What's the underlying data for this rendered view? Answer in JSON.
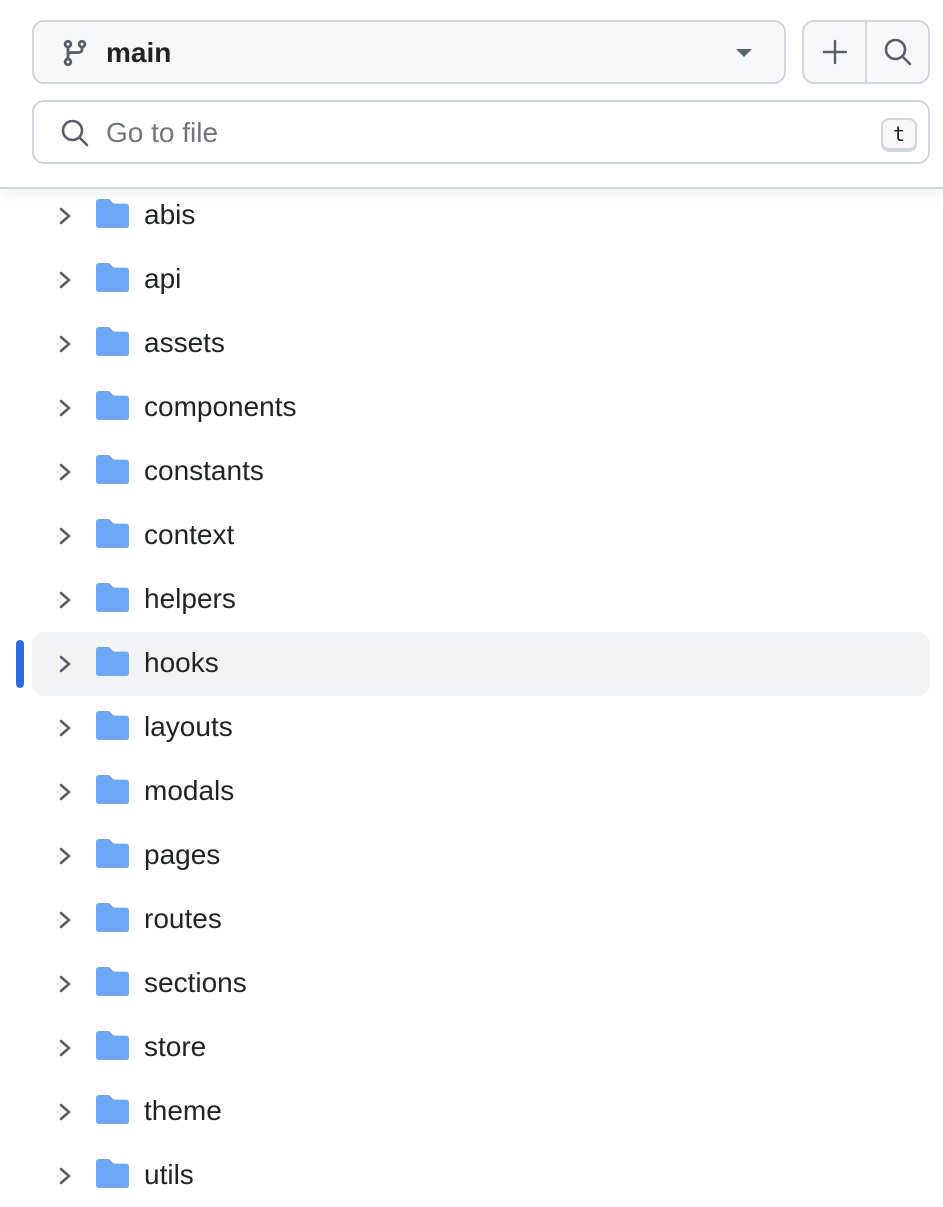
{
  "branch": {
    "name": "main",
    "icon": "git-branch-icon"
  },
  "actions": {
    "add_icon": "plus-icon",
    "search_icon": "search-icon"
  },
  "file_search": {
    "placeholder": "Go to file",
    "value": "",
    "shortcut": "t"
  },
  "colors": {
    "folder": "#6ea8f5",
    "selection_accent": "#2b6edb",
    "selected_row_bg": "#f2f3f5"
  },
  "tree": {
    "selected": "hooks",
    "items": [
      {
        "label": "abis",
        "type": "folder",
        "expanded": false
      },
      {
        "label": "api",
        "type": "folder",
        "expanded": false
      },
      {
        "label": "assets",
        "type": "folder",
        "expanded": false
      },
      {
        "label": "components",
        "type": "folder",
        "expanded": false
      },
      {
        "label": "constants",
        "type": "folder",
        "expanded": false
      },
      {
        "label": "context",
        "type": "folder",
        "expanded": false
      },
      {
        "label": "helpers",
        "type": "folder",
        "expanded": false
      },
      {
        "label": "hooks",
        "type": "folder",
        "expanded": false
      },
      {
        "label": "layouts",
        "type": "folder",
        "expanded": false
      },
      {
        "label": "modals",
        "type": "folder",
        "expanded": false
      },
      {
        "label": "pages",
        "type": "folder",
        "expanded": false
      },
      {
        "label": "routes",
        "type": "folder",
        "expanded": false
      },
      {
        "label": "sections",
        "type": "folder",
        "expanded": false
      },
      {
        "label": "store",
        "type": "folder",
        "expanded": false
      },
      {
        "label": "theme",
        "type": "folder",
        "expanded": false
      },
      {
        "label": "utils",
        "type": "folder",
        "expanded": false
      }
    ]
  }
}
